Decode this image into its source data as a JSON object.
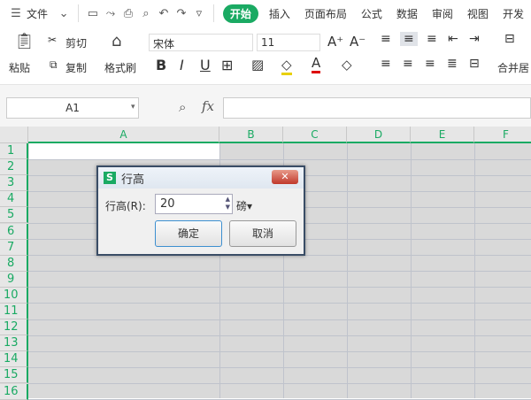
{
  "menubar": {
    "file": "文件",
    "tabs": [
      "开始",
      "插入",
      "页面布局",
      "公式",
      "数据",
      "审阅",
      "视图",
      "开发"
    ]
  },
  "ribbon": {
    "paste": "粘贴",
    "cut": "剪切",
    "copy": "复制",
    "format_painter": "格式刷",
    "font": "宋体",
    "size": "11",
    "merge": "合并居"
  },
  "formula": {
    "namebox": "A1",
    "fx": "fx"
  },
  "grid": {
    "columns": [
      "A",
      "B",
      "C",
      "D",
      "E",
      "F"
    ],
    "rows": [
      "1",
      "2",
      "3",
      "4",
      "5",
      "6",
      "7",
      "8",
      "9",
      "10",
      "11",
      "12",
      "13",
      "14",
      "15",
      "16"
    ]
  },
  "dialog": {
    "logo": "S",
    "title": "行高",
    "label": "行高(R):",
    "value": "20",
    "unit": "磅",
    "ok": "确定",
    "cancel": "取消"
  },
  "colors": {
    "accent": "#1aaa63"
  }
}
